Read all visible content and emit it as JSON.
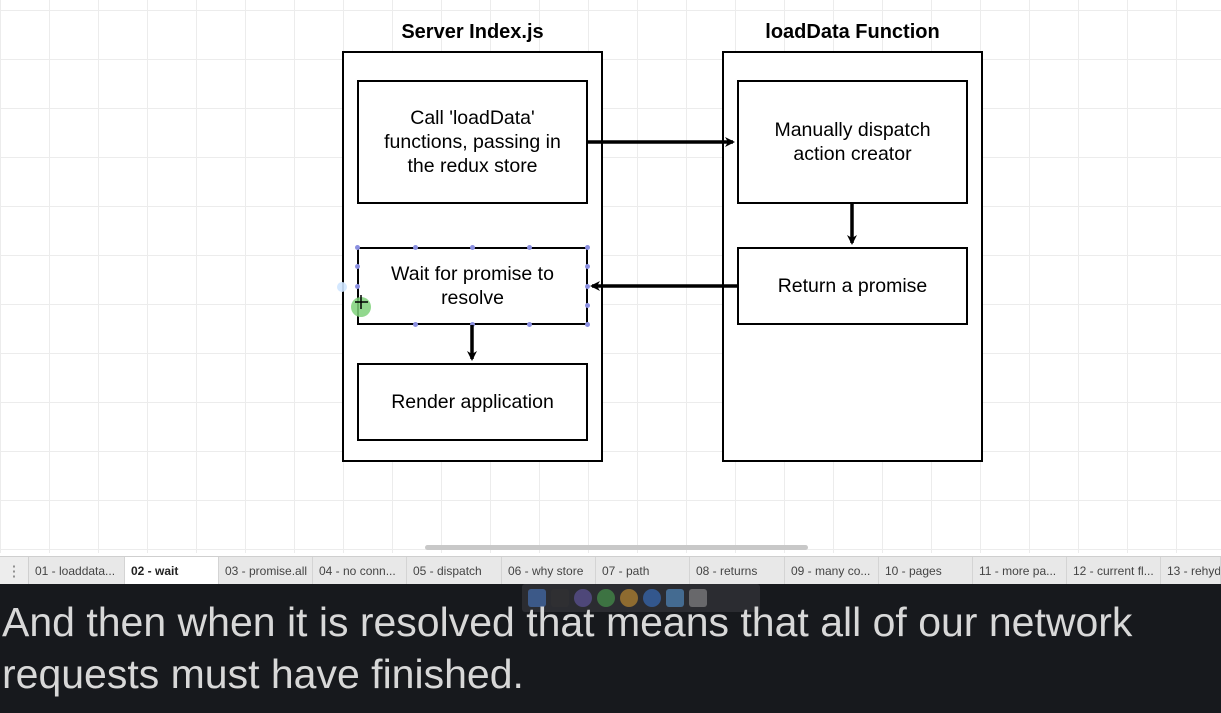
{
  "diagram": {
    "left_column_title": "Server Index.js",
    "right_column_title": "loadData Function",
    "boxes": {
      "call_load_data": "Call 'loadData'\nfunctions, passing in\nthe redux store",
      "wait_for_promise": "Wait for promise to\nresolve",
      "render_application": "Render application",
      "manually_dispatch": "Manually dispatch\naction creator",
      "return_promise": "Return a promise"
    }
  },
  "tabs": [
    {
      "label": "01 - loaddata...",
      "active": false
    },
    {
      "label": "02 - wait",
      "active": true
    },
    {
      "label": "03 - promise.all",
      "active": false
    },
    {
      "label": "04 - no conn...",
      "active": false
    },
    {
      "label": "05 - dispatch",
      "active": false
    },
    {
      "label": "06 - why store",
      "active": false
    },
    {
      "label": "07 - path",
      "active": false
    },
    {
      "label": "08 - returns",
      "active": false
    },
    {
      "label": "09 - many co...",
      "active": false
    },
    {
      "label": "10 - pages",
      "active": false
    },
    {
      "label": "11 - more pa...",
      "active": false
    },
    {
      "label": "12 - current fl...",
      "active": false
    },
    {
      "label": "13 - rehyd",
      "active": false
    }
  ],
  "caption": {
    "text": "And then when it is resolved that means that all of our network requests must have finished."
  },
  "colors": {
    "caption_background": "#17191d",
    "caption_text": "#d8d8d8",
    "selection_handle": "#8a8fe0"
  }
}
